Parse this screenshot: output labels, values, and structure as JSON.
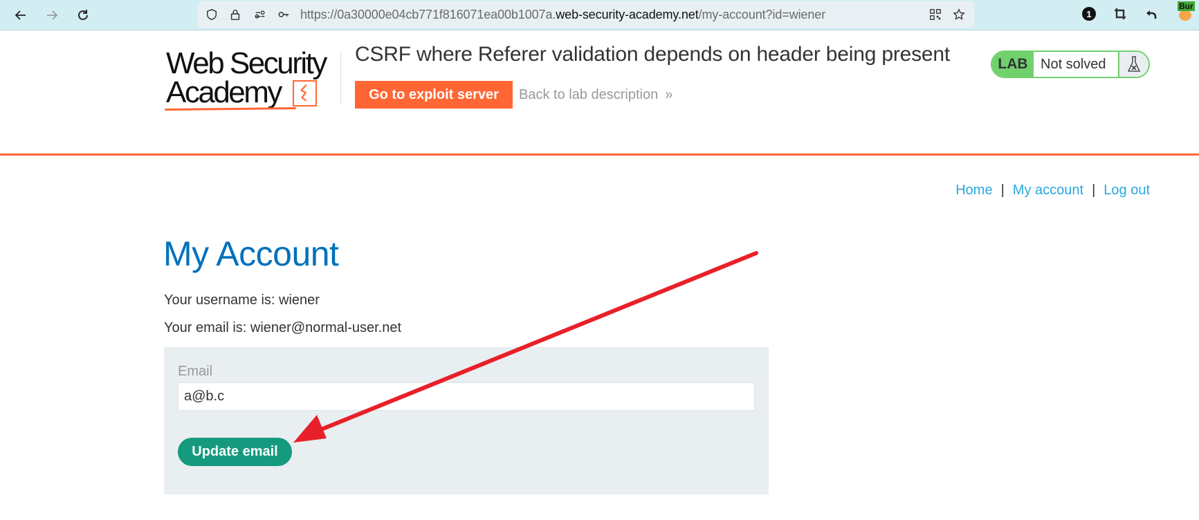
{
  "browser": {
    "url_prefix": "https://0a30000e04cb771f816071ea00b1007a.",
    "url_domain": "web-security-academy.net",
    "url_path": "/my-account?id=wiener",
    "notification_count": "1",
    "extension_label": "Bur"
  },
  "header": {
    "logo_line1": "Web Security",
    "logo_line2": "Academy",
    "lab_title": "CSRF where Referer validation depends on header being present",
    "exploit_button": "Go to exploit server",
    "back_link": "Back to lab description",
    "back_chevron": "»",
    "lab_badge": "LAB",
    "lab_status": "Not solved"
  },
  "nav": {
    "links": [
      "Home",
      "My account",
      "Log out"
    ],
    "separator": "|"
  },
  "account": {
    "title": "My Account",
    "username_line": "Your username is: wiener",
    "email_line": "Your email is: wiener@normal-user.net",
    "form": {
      "email_label": "Email",
      "email_value": "a@b.c",
      "submit_label": "Update email"
    }
  },
  "colors": {
    "brand_orange": "#ff6633",
    "title_blue": "#0071bc",
    "link_blue": "#29a8e0",
    "lab_green": "#70d16d",
    "button_teal": "#159a7f",
    "annotation_red": "#e8202a"
  }
}
